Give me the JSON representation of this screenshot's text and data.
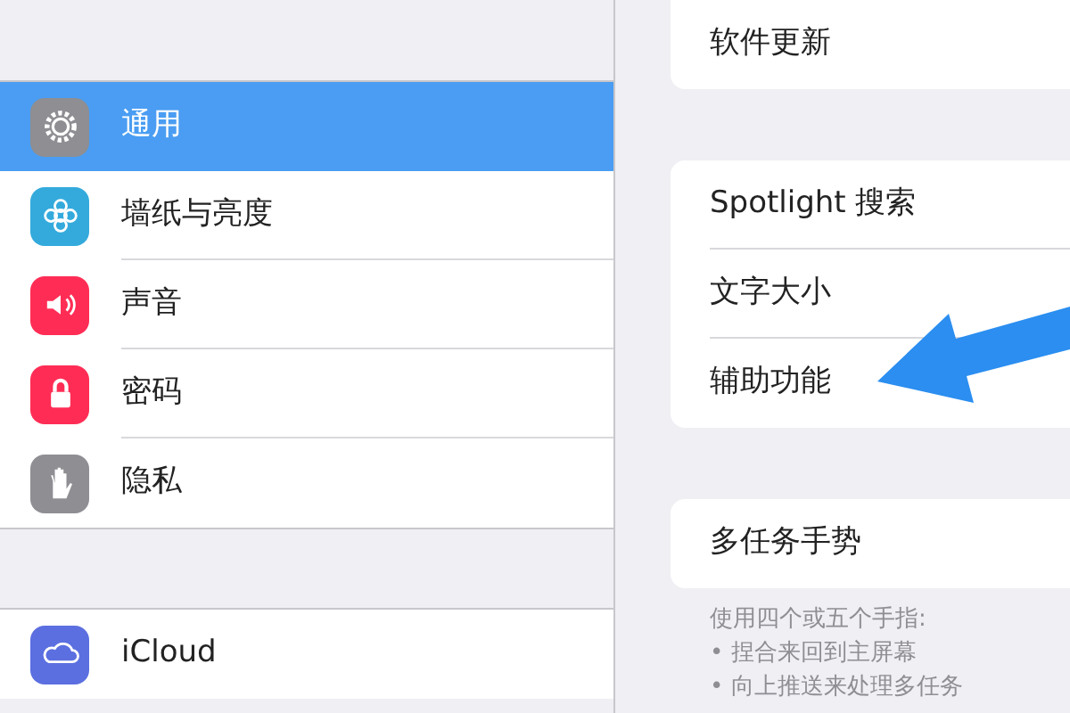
{
  "sidebar": {
    "groups": [
      {
        "items": [
          {
            "label": "通用",
            "kind": "gear",
            "color": "#8e8e93",
            "selected": true
          },
          {
            "label": "墙纸与亮度",
            "kind": "flower",
            "color": "#34aadc",
            "selected": false
          },
          {
            "label": "声音",
            "kind": "speaker",
            "color": "#ff2d55",
            "selected": false
          },
          {
            "label": "密码",
            "kind": "lock",
            "color": "#ff2d55",
            "selected": false
          },
          {
            "label": "隐私",
            "kind": "hand",
            "color": "#8e8e93",
            "selected": false
          }
        ]
      },
      {
        "items": [
          {
            "label": "iCloud",
            "kind": "cloud",
            "color": "#5b6fe0",
            "selected": false
          }
        ]
      }
    ]
  },
  "detail": {
    "groups": [
      {
        "rows": [
          "软件更新"
        ]
      },
      {
        "rows": [
          "Spotlight 搜索",
          "文字大小",
          "辅助功能"
        ]
      },
      {
        "rows": [
          "多任务手势"
        ],
        "footer": [
          "使用四个或五个手指:",
          "• 捏合来回到主屏幕",
          "• 向上推送来处理多任务"
        ]
      }
    ]
  },
  "annotation": {
    "kind": "arrow"
  }
}
